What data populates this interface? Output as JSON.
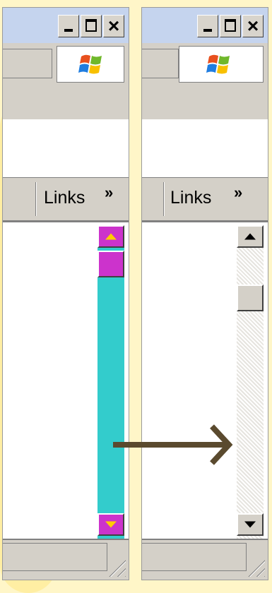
{
  "colors": {
    "background": "#fff6c8",
    "custom_track": "#33cccc",
    "custom_buttons": "#cc33cc",
    "custom_arrows": "#ffcc00",
    "classic_face": "#d4d0c8",
    "annotation_arrow": "#5a4a2e"
  },
  "windows": [
    {
      "name": "customized",
      "caption_buttons": [
        "minimize-icon",
        "maximize-icon",
        "close-icon"
      ],
      "close_glyph": "×",
      "links_label": "Links",
      "chevron": "»",
      "scrollbar_style": "custom-colors"
    },
    {
      "name": "classic",
      "caption_buttons": [
        "minimize-icon",
        "maximize-icon",
        "close-icon"
      ],
      "close_glyph": "×",
      "links_label": "Links",
      "chevron": "»",
      "scrollbar_style": "classic"
    }
  ],
  "annotation": {
    "icon": "right-arrow-icon"
  }
}
